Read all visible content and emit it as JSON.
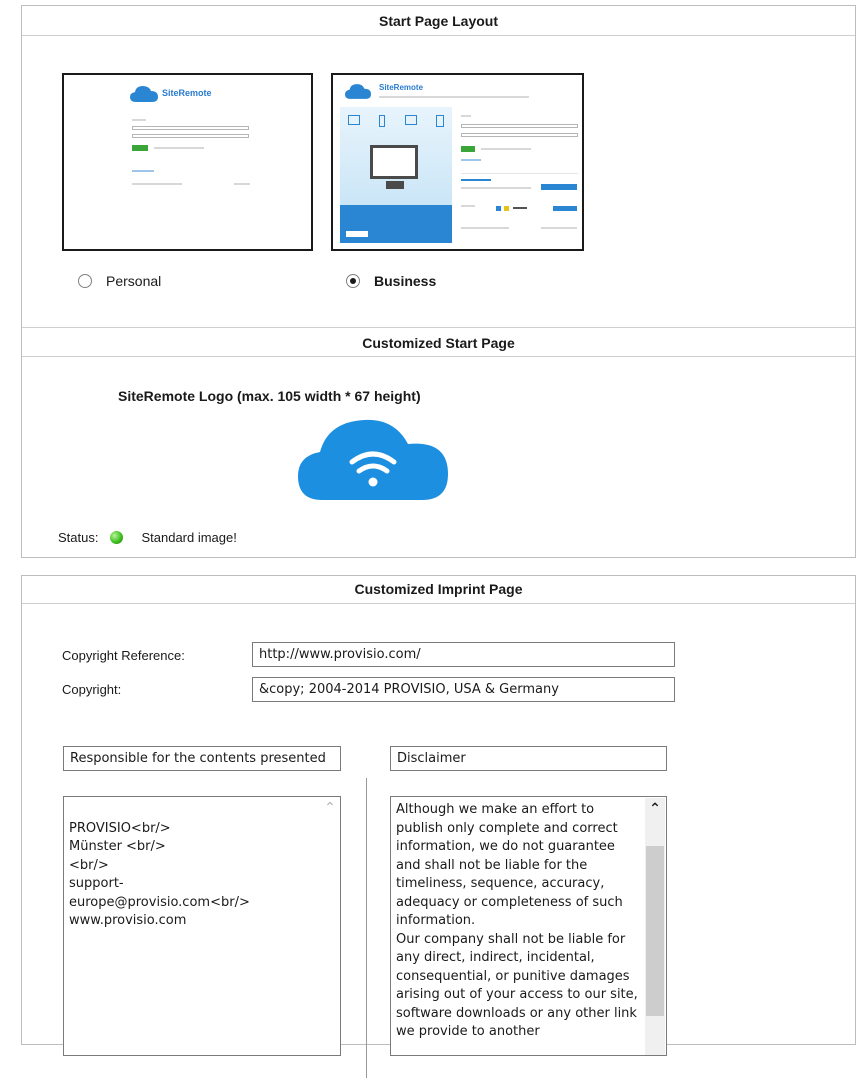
{
  "start_page": {
    "header": "Start Page Layout",
    "personal_thumb": {
      "brand": "SiteRemote"
    },
    "business_thumb": {
      "brand": "SiteRemote"
    },
    "options": [
      {
        "label": "Personal",
        "checked": false
      },
      {
        "label": "Business",
        "checked": true
      }
    ]
  },
  "custom_start": {
    "header": "Customized Start Page",
    "logo_caption": "SiteRemote Logo (max. 105 width * 67 height)",
    "logo_icon": "wifi-cloud-icon",
    "status_label": "Status:",
    "status_text": "Standard image!",
    "status_color": "#3fbf1f"
  },
  "imprint": {
    "header": "Customized Imprint Page",
    "copyright_reference_label": "Copyright Reference:",
    "copyright_reference_value": "http://www.provisio.com/",
    "copyright_label": "Copyright:",
    "copyright_value": "&copy; 2004-2014 PROVISIO, USA & Germany",
    "responsible_title": "Responsible for the contents presented",
    "responsible_text": "\nPROVISIO<br/>\nMünster <br/>\n<br/>\nsupport-\neurope@provisio.com<br/>\nwww.provisio.com",
    "disclaimer_title": "Disclaimer",
    "disclaimer_text": "Although we make an effort to publish only complete and correct information, we do not guarantee and shall not be liable for the timeliness, sequence, accuracy, adequacy or completeness of such information.\nOur company shall not be liable for any direct, indirect, incidental, consequential, or punitive damages arising out of your access to our site, software downloads or any other link we provide to another"
  },
  "colors": {
    "brand_blue": "#2a86d2",
    "cloud_blue": "#1c8fe0",
    "panel_border": "#bdbdbd"
  }
}
